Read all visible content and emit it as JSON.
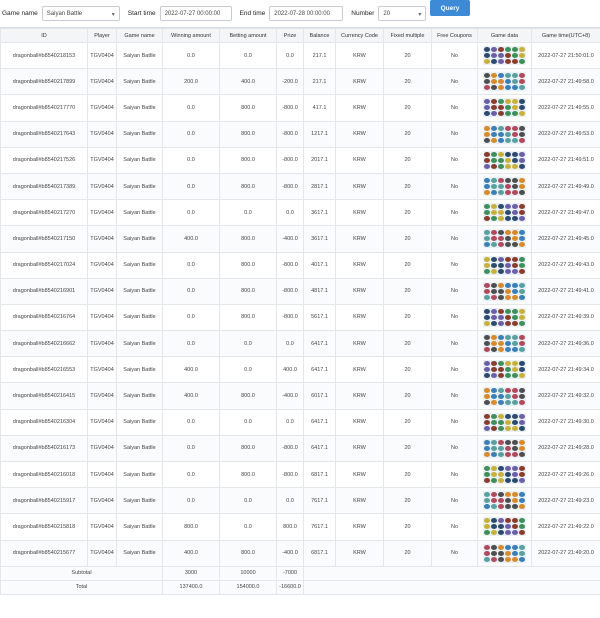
{
  "filters": {
    "game_name_label": "Game name",
    "game_name_value": "Saiyan Battle",
    "start_time_label": "Start time",
    "start_time_value": "2022-07-27 00:00:00",
    "end_time_label": "End time",
    "end_time_value": "2022-07-28 00:00:00",
    "number_label": "Number",
    "number_value": "20",
    "query_label": "Query"
  },
  "table": {
    "columns": [
      "ID",
      "Player",
      "Game name",
      "Winning amount",
      "Betting amount",
      "Prize",
      "Balance",
      "Currency Code",
      "Fixed multiple",
      "Free Coupons",
      "Game data",
      "Game time(UTC+8)"
    ],
    "rows": [
      [
        "dragonball#b8540218153",
        "TGV0404",
        "Saiyan Battle",
        "0.0",
        "0.0",
        "0.0",
        "217.1",
        "KRW",
        "20",
        "No",
        "",
        "2022-07-27 21:50:01.0"
      ],
      [
        "dragonball#b8540217899",
        "TGV0404",
        "Saiyan Battle",
        "200.0",
        "400.0",
        "-200.0",
        "217.1",
        "KRW",
        "20",
        "No",
        "",
        "2022-07-27 21:49:58.0"
      ],
      [
        "dragonball#b8540217770",
        "TGV0404",
        "Saiyan Battle",
        "0.0",
        "800.0",
        "-800.0",
        "417.1",
        "KRW",
        "20",
        "No",
        "",
        "2022-07-27 21:49:55.0"
      ],
      [
        "dragonball#b8540217643",
        "TGV0404",
        "Saiyan Battle",
        "0.0",
        "800.0",
        "-800.0",
        "1217.1",
        "KRW",
        "20",
        "No",
        "",
        "2022-07-27 21:49:53.0"
      ],
      [
        "dragonball#b8540217526",
        "TGV0404",
        "Saiyan Battle",
        "0.0",
        "800.0",
        "-800.0",
        "2017.1",
        "KRW",
        "20",
        "No",
        "",
        "2022-07-27 21:49:51.0"
      ],
      [
        "dragonball#b8540217389",
        "TGV0404",
        "Saiyan Battle",
        "0.0",
        "800.0",
        "-800.0",
        "2817.1",
        "KRW",
        "20",
        "No",
        "",
        "2022-07-27 21:49:49.0"
      ],
      [
        "dragonball#b8540217270",
        "TGV0404",
        "Saiyan Battle",
        "0.0",
        "0.0",
        "0.0",
        "3617.1",
        "KRW",
        "20",
        "No",
        "",
        "2022-07-27 21:49:47.0"
      ],
      [
        "dragonball#b8540217150",
        "TGV0404",
        "Saiyan Battle",
        "400.0",
        "800.0",
        "-400.0",
        "3617.1",
        "KRW",
        "20",
        "No",
        "",
        "2022-07-27 21:49:45.0"
      ],
      [
        "dragonball#b8540217024",
        "TGV0404",
        "Saiyan Battle",
        "0.0",
        "800.0",
        "-800.0",
        "4017.1",
        "KRW",
        "20",
        "No",
        "",
        "2022-07-27 21:49:43.0"
      ],
      [
        "dragonball#b8540216901",
        "TGV0404",
        "Saiyan Battle",
        "0.0",
        "800.0",
        "-800.0",
        "4817.1",
        "KRW",
        "20",
        "No",
        "",
        "2022-07-27 21:49:41.0"
      ],
      [
        "dragonball#b8540216764",
        "TGV0404",
        "Saiyan Battle",
        "0.0",
        "800.0",
        "-800.0",
        "5617.1",
        "KRW",
        "20",
        "No",
        "",
        "2022-07-27 21:49:39.0"
      ],
      [
        "dragonball#b8540216662",
        "TGV0404",
        "Saiyan Battle",
        "0.0",
        "0.0",
        "0.0",
        "6417.1",
        "KRW",
        "20",
        "No",
        "",
        "2022-07-27 21:49:36.0"
      ],
      [
        "dragonball#b8540216553",
        "TGV0404",
        "Saiyan Battle",
        "400.0",
        "0.0",
        "400.0",
        "6417.1",
        "KRW",
        "20",
        "No",
        "",
        "2022-07-27 21:49:34.0"
      ],
      [
        "dragonball#b8540216415",
        "TGV0404",
        "Saiyan Battle",
        "400.0",
        "800.0",
        "-400.0",
        "6017.1",
        "KRW",
        "20",
        "No",
        "",
        "2022-07-27 21:49:32.0"
      ],
      [
        "dragonball#b8540216304",
        "TGV0404",
        "Saiyan Battle",
        "0.0",
        "0.0",
        "0.0",
        "6417.1",
        "KRW",
        "20",
        "No",
        "",
        "2022-07-27 21:49:30.0"
      ],
      [
        "dragonball#b8540216173",
        "TGV0404",
        "Saiyan Battle",
        "0.0",
        "800.0",
        "-800.0",
        "6417.1",
        "KRW",
        "20",
        "No",
        "",
        "2022-07-27 21:49:28.0"
      ],
      [
        "dragonball#b8540216018",
        "TGV0404",
        "Saiyan Battle",
        "0.0",
        "800.0",
        "-800.0",
        "6817.1",
        "KRW",
        "20",
        "No",
        "",
        "2022-07-27 21:49:26.0"
      ],
      [
        "dragonball#b8540215917",
        "TGV0404",
        "Saiyan Battle",
        "0.0",
        "0.0",
        "0.0",
        "7617.1",
        "KRW",
        "20",
        "No",
        "",
        "2022-07-27 21:49:23.0"
      ],
      [
        "dragonball#b8540215818",
        "TGV0404",
        "Saiyan Battle",
        "800.0",
        "0.0",
        "800.0",
        "7617.1",
        "KRW",
        "20",
        "No",
        "",
        "2022-07-27 21:49:22.0"
      ],
      [
        "dragonball#b8540215677",
        "TGV0404",
        "Saiyan Battle",
        "400.0",
        "800.0",
        "-400.0",
        "6817.1",
        "KRW",
        "20",
        "No",
        "",
        "2022-07-27 21:49:20.0"
      ]
    ],
    "subtotal": {
      "label": "Subtotal",
      "winning": "3000",
      "betting": "10000",
      "prize": "-7000"
    },
    "total": {
      "label": "Total",
      "winning": "137400.0",
      "betting": "154000.0",
      "prize": "-16600.0"
    },
    "game_data_colors": [
      "#2c4a6e",
      "#d98a2b",
      "#3f8f5a",
      "#b34a5b",
      "#6c5fa8",
      "#3a7fb8",
      "#c9b03a",
      "#4e4e4e",
      "#8a3d2c",
      "#5aa0a0"
    ]
  }
}
